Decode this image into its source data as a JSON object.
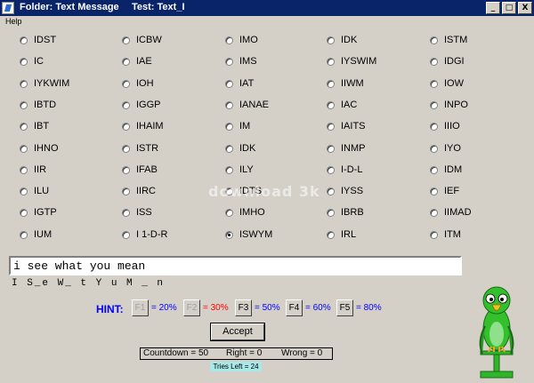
{
  "titlebar": {
    "folder": "Folder: Text Message",
    "test": "Test: Text_I",
    "buttons": [
      "_",
      "□",
      "X"
    ]
  },
  "menu": {
    "help": "Help"
  },
  "options": [
    {
      "label": "IDST",
      "selected": false
    },
    {
      "label": "ICBW",
      "selected": false
    },
    {
      "label": "IMO",
      "selected": false
    },
    {
      "label": "IDK",
      "selected": false
    },
    {
      "label": "ISTM",
      "selected": false
    },
    {
      "label": "IC",
      "selected": false
    },
    {
      "label": "IAE",
      "selected": false
    },
    {
      "label": "IMS",
      "selected": false
    },
    {
      "label": "IYSWIM",
      "selected": false
    },
    {
      "label": "IDGI",
      "selected": false
    },
    {
      "label": "IYKWIM",
      "selected": false
    },
    {
      "label": "IOH",
      "selected": false
    },
    {
      "label": "IAT",
      "selected": false
    },
    {
      "label": "IIWM",
      "selected": false
    },
    {
      "label": "IOW",
      "selected": false
    },
    {
      "label": "IBTD",
      "selected": false
    },
    {
      "label": "IGGP",
      "selected": false
    },
    {
      "label": "IANAE",
      "selected": false
    },
    {
      "label": "IAC",
      "selected": false
    },
    {
      "label": "INPO",
      "selected": false
    },
    {
      "label": "IBT",
      "selected": false
    },
    {
      "label": "IHAIM",
      "selected": false
    },
    {
      "label": "IM",
      "selected": false
    },
    {
      "label": "IAITS",
      "selected": false
    },
    {
      "label": "IIIO",
      "selected": false
    },
    {
      "label": "IHNO",
      "selected": false
    },
    {
      "label": "ISTR",
      "selected": false
    },
    {
      "label": "IDK",
      "selected": false
    },
    {
      "label": "INMP",
      "selected": false
    },
    {
      "label": "IYO",
      "selected": false
    },
    {
      "label": "IIR",
      "selected": false
    },
    {
      "label": "IFAB",
      "selected": false
    },
    {
      "label": "ILY",
      "selected": false
    },
    {
      "label": "I-D-L",
      "selected": false
    },
    {
      "label": "IDM",
      "selected": false
    },
    {
      "label": "ILU",
      "selected": false
    },
    {
      "label": "IIRC",
      "selected": false
    },
    {
      "label": "IDTS",
      "selected": false
    },
    {
      "label": "IYSS",
      "selected": false
    },
    {
      "label": "IEF",
      "selected": false
    },
    {
      "label": "IGTP",
      "selected": false
    },
    {
      "label": "ISS",
      "selected": false
    },
    {
      "label": "IMHO",
      "selected": false
    },
    {
      "label": "IBRB",
      "selected": false
    },
    {
      "label": "IIMAD",
      "selected": false
    },
    {
      "label": "IUM",
      "selected": false
    },
    {
      "label": "I 1-D-R",
      "selected": false
    },
    {
      "label": "ISWYM",
      "selected": true
    },
    {
      "label": "IRL",
      "selected": false
    },
    {
      "label": "ITM",
      "selected": false
    }
  ],
  "watermark": "download 3k",
  "answer": "i see what you mean",
  "pattern": "I S_e W_ t Y u M _ n",
  "hint": {
    "label": "HINT:",
    "keys": [
      {
        "key": "F1",
        "pct": "= 20%",
        "disabled": true
      },
      {
        "key": "F2",
        "pct": "= 30%",
        "disabled": true
      },
      {
        "key": "F3",
        "pct": "= 50%",
        "disabled": false
      },
      {
        "key": "F4",
        "pct": "= 60%",
        "disabled": false
      },
      {
        "key": "F5",
        "pct": "= 80%",
        "disabled": false
      }
    ]
  },
  "accept": "Accept",
  "stats": {
    "countdown": "Countdown = 50",
    "right": "Right = 0",
    "wrong": "Wrong = 0"
  },
  "tries": {
    "label": "Tries Left =",
    "value": "24"
  },
  "colors": {
    "titlebar": "#0a246a",
    "hint": "#0000ff",
    "hint_alert": "#ff0000",
    "tries_bg": "#a8e8e8",
    "parrot": "#2fb52a"
  }
}
